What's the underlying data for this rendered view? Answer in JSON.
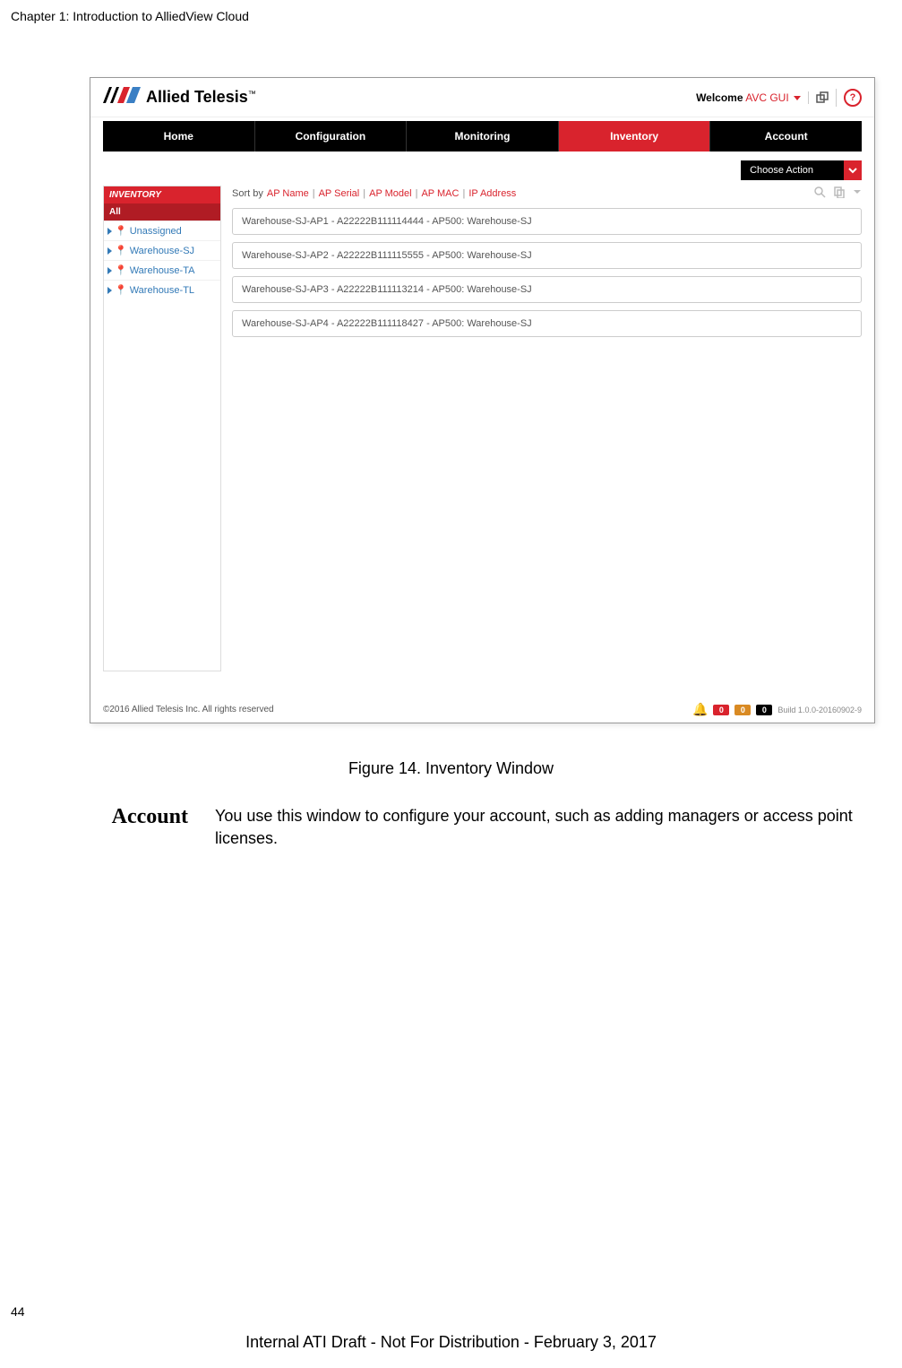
{
  "chapter_header": "Chapter 1: Introduction to AlliedView Cloud",
  "page_number": "44",
  "footer_distrib": "Internal ATI Draft - Not For Distribution - February 3, 2017",
  "logo_text": "Allied Telesis",
  "logo_tm": "™",
  "welcome_label": "Welcome",
  "avc_gui": "AVC GUI",
  "nav": {
    "home": "Home",
    "configuration": "Configuration",
    "monitoring": "Monitoring",
    "inventory": "Inventory",
    "account": "Account"
  },
  "choose_action": "Choose Action",
  "sidebar": {
    "header": "INVENTORY",
    "all": "All",
    "items": [
      {
        "label": "Unassigned"
      },
      {
        "label": "Warehouse-SJ"
      },
      {
        "label": "Warehouse-TA"
      },
      {
        "label": "Warehouse-TL"
      }
    ]
  },
  "sort": {
    "label": "Sort by",
    "options": [
      "AP Name",
      "AP Serial",
      "AP Model",
      "AP MAC",
      "IP Address"
    ]
  },
  "ap_rows": [
    "Warehouse-SJ-AP1 - A22222B111114444 - AP500: Warehouse-SJ",
    "Warehouse-SJ-AP2 - A22222B111115555 - AP500: Warehouse-SJ",
    "Warehouse-SJ-AP3 - A22222B111113214 - AP500: Warehouse-SJ",
    "Warehouse-SJ-AP4 - A22222B111118427 - AP500: Warehouse-SJ"
  ],
  "ss_footer_left": "©2016 Allied Telesis Inc. All rights reserved",
  "badges": {
    "red": "0",
    "orange": "0",
    "black": "0"
  },
  "build": "Build 1.0.0-20160902-9",
  "figure_caption": "Figure 14. Inventory Window",
  "section": {
    "label": "Account",
    "body": "You use this window to configure your account, such as adding managers or access point licenses."
  }
}
